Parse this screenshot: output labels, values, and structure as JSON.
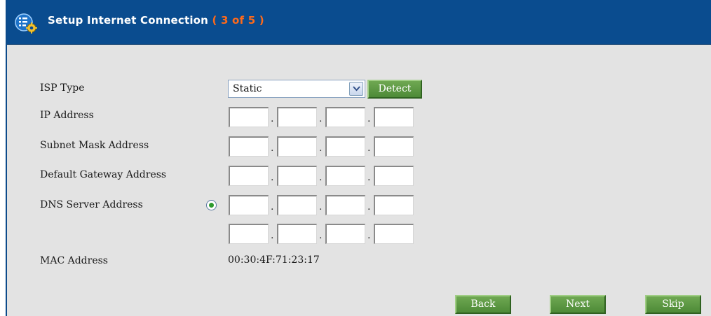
{
  "header": {
    "title": "Setup Internet Connection",
    "step": "( 3 of 5 )"
  },
  "form": {
    "isp_type_label": "ISP Type",
    "isp_type_value": "Static",
    "detect_label": "Detect",
    "ip_label": "IP Address",
    "subnet_label": "Subnet Mask Address",
    "gateway_label": "Default Gateway Address",
    "dns_label": "DNS Server Address",
    "mac_label": "MAC Address",
    "mac_value": "00:30:4F:71:23:17",
    "dns_radio_selected": true
  },
  "footer": {
    "back_label": "Back",
    "next_label": "Next",
    "skip_label": "Skip"
  },
  "colors": {
    "header_bg": "#0a4c8f",
    "step_accent": "#ff6a1a",
    "button_green": "#5a9a42",
    "panel_bg": "#e3e3e3"
  }
}
